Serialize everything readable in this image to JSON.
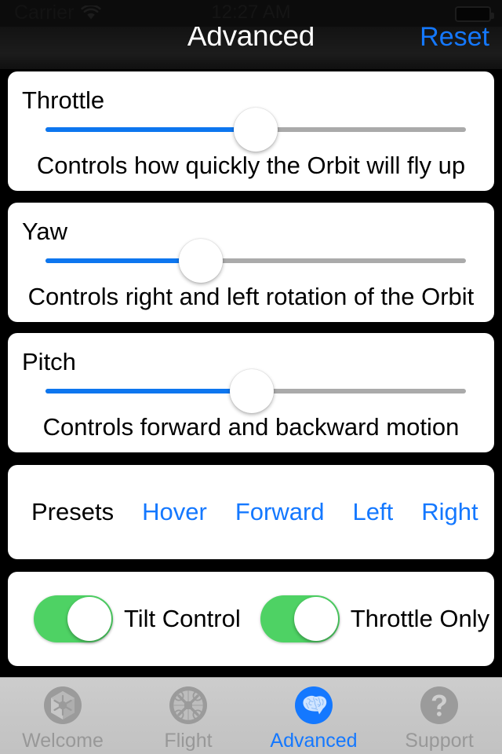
{
  "status_bar": {
    "carrier": "Carrier",
    "wifi_icon": "wifi-icon",
    "time": "12:27 AM",
    "battery_icon": "battery-icon"
  },
  "nav_bar": {
    "title": "Advanced",
    "reset_label": "Reset",
    "accent_color": "#1478ff"
  },
  "sliders": [
    {
      "name": "throttle",
      "label": "Throttle",
      "description": "Controls how quickly the Orbit will fly up",
      "value_percent": 50,
      "fill_color": "#0d76ef",
      "track_color": "#aaaaaa"
    },
    {
      "name": "yaw",
      "label": "Yaw",
      "description": "Controls right and left rotation of the Orbit",
      "value_percent": 37,
      "fill_color": "#0d76ef",
      "track_color": "#aaaaaa"
    },
    {
      "name": "pitch",
      "label": "Pitch",
      "description": "Controls forward and backward motion",
      "value_percent": 49,
      "fill_color": "#0d76ef",
      "track_color": "#aaaaaa"
    }
  ],
  "presets": {
    "title": "Presets",
    "buttons": [
      {
        "label": "Hover"
      },
      {
        "label": "Forward"
      },
      {
        "label": "Left"
      },
      {
        "label": "Right"
      }
    ],
    "button_color": "#1478ff"
  },
  "toggles": [
    {
      "name": "tilt-control",
      "label": "Tilt Control",
      "on": true,
      "on_color": "#4ed264"
    },
    {
      "name": "throttle-only",
      "label": "Throttle Only",
      "on": true,
      "on_color": "#4ed264"
    }
  ],
  "tab_bar": {
    "active_index": 2,
    "active_color": "#1478ff",
    "inactive_color": "#989898",
    "items": [
      {
        "label": "Welcome",
        "icon": "drone-hexagon-icon"
      },
      {
        "label": "Flight",
        "icon": "quadcopter-icon"
      },
      {
        "label": "Advanced",
        "icon": "brain-icon"
      },
      {
        "label": "Support",
        "icon": "question-mark-icon"
      }
    ]
  }
}
